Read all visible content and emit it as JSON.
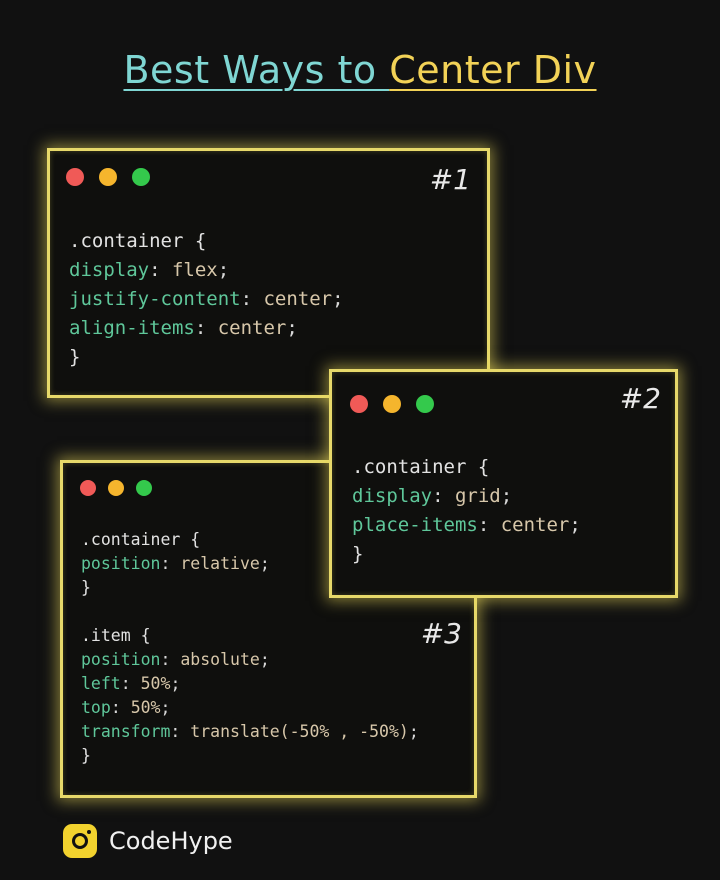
{
  "title": {
    "part1": "Best Ways to ",
    "part2": "Center Div"
  },
  "colors": {
    "background": "#111111",
    "title_teal": "#7fd6d3",
    "title_yellow": "#f2d257",
    "window_border": "#e7d96a",
    "property": "#5fc79a",
    "value": "#d7c7aa"
  },
  "windows": [
    {
      "number": "#1",
      "lines": [
        {
          "sel": ".container {"
        },
        {
          "prop": "display",
          "sep": ": ",
          "val": "flex",
          "end": ";"
        },
        {
          "prop": "justify-content",
          "sep": ": ",
          "val": "center",
          "end": ";"
        },
        {
          "prop": "align-items",
          "sep": ": ",
          "val": "center",
          "end": ";"
        },
        {
          "sel": "}"
        }
      ]
    },
    {
      "number": "#2",
      "lines": [
        {
          "sel": ".container {"
        },
        {
          "prop": "display",
          "sep": ": ",
          "val": "grid",
          "end": ";"
        },
        {
          "prop": "place-items",
          "sep": ": ",
          "val": "center",
          "end": ";"
        },
        {
          "sel": "}"
        }
      ]
    },
    {
      "number": "#3",
      "lines": [
        {
          "sel": ".container {"
        },
        {
          "prop": "position",
          "sep": ": ",
          "val": "relative",
          "end": ";"
        },
        {
          "sel": "}"
        },
        {
          "blank": true
        },
        {
          "sel": ".item {"
        },
        {
          "prop": "position",
          "sep": ": ",
          "val": "absolute",
          "end": ";"
        },
        {
          "prop": "left",
          "sep": ": ",
          "val": "50%",
          "end": ";"
        },
        {
          "prop": "top",
          "sep": ": ",
          "val": "50%",
          "end": ";"
        },
        {
          "prop": "transform",
          "sep": ": ",
          "val": "translate(-50% , -50%)",
          "end": ";"
        },
        {
          "sel": "}"
        }
      ]
    }
  ],
  "brand": {
    "name": "CodeHype",
    "icon": "camera-icon"
  }
}
